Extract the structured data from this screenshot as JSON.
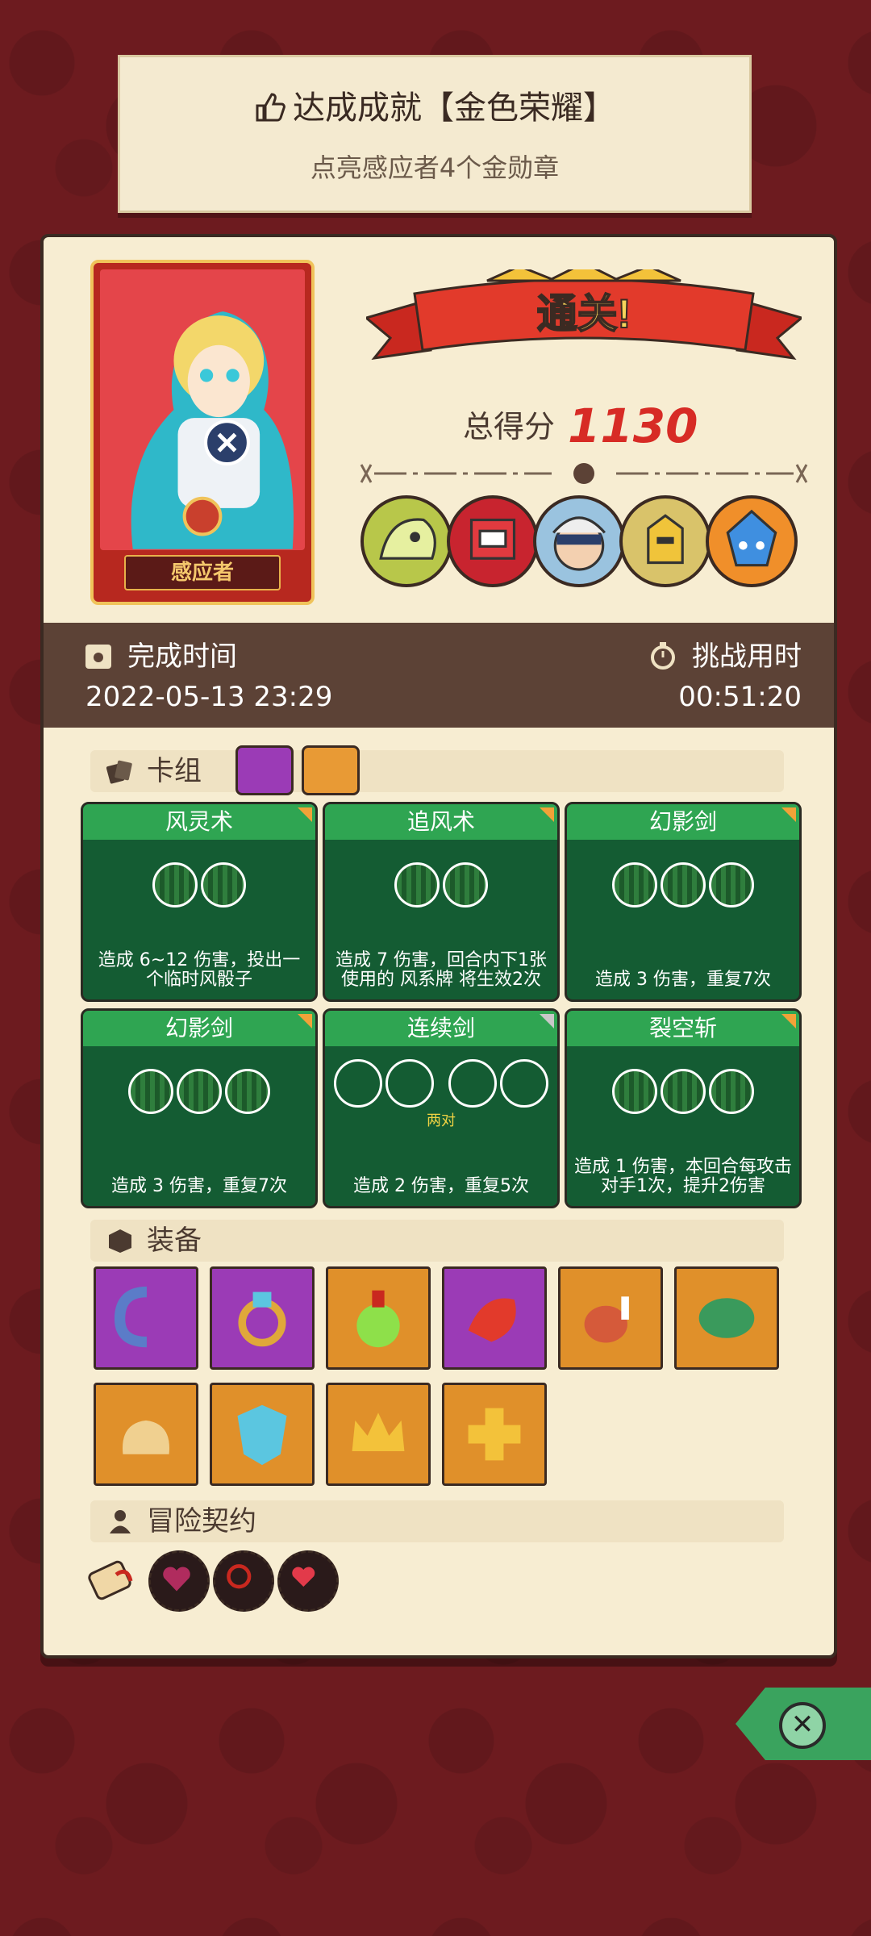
{
  "achievement": {
    "title": "达成成就【金色荣耀】",
    "subtitle": "点亮感应者4个金勋章"
  },
  "hero": {
    "name": "感应者"
  },
  "result": {
    "banner": "通关!",
    "score_label": "总得分",
    "score": "1130"
  },
  "bosses": [
    "skull-dino-boss",
    "red-robot-boss",
    "masked-kid-boss",
    "golden-knight-boss",
    "blue-crystal-boss"
  ],
  "times": {
    "complete_label": "完成时间",
    "complete_value": "2022-05-13 23:29",
    "challenge_label": "挑战用时",
    "challenge_value": "00:51:20"
  },
  "deck": {
    "title": "卡组",
    "cards": [
      {
        "name": "风灵术",
        "orbs": 2,
        "desc": "造成 6~12 伤害，投出一个临时风骰子"
      },
      {
        "name": "追风术",
        "orbs": 2,
        "desc": "造成 7 伤害，回合内下1张使用的 风系牌 将生效2次"
      },
      {
        "name": "幻影剑",
        "orbs": 3,
        "desc": "造成 3 伤害，重复7次"
      },
      {
        "name": "幻影剑",
        "orbs": 3,
        "desc": "造成 3 伤害，重复7次"
      },
      {
        "name": "连续剑",
        "orbs": 0,
        "pair": "两对",
        "desc": "造成 2 伤害，重复5次"
      },
      {
        "name": "裂空斩",
        "orbs": 3,
        "desc": "造成 1 伤害，本回合每攻击对手1次，提升2伤害"
      }
    ]
  },
  "equipment": {
    "title": "装备",
    "items": [
      "hook-icon",
      "ring-icon",
      "potion-icon",
      "red-dragon-icon",
      "meat-icon",
      "turtle-shell-icon",
      "sack-icon",
      "shield-icon",
      "crown-icon",
      "cross-medal-icon"
    ],
    "colors": [
      "#9b3bb6",
      "#9b3bb6",
      "#e0902a",
      "#9b3bb6",
      "#e0902a",
      "#e0902a",
      "#e0902a",
      "#e0902a",
      "#e0902a",
      "#e0902a"
    ]
  },
  "contracts": {
    "title": "冒险契约"
  },
  "colors": {
    "bg": "#6d1b1f",
    "card_green": "#145c33",
    "header_green": "#2fa552",
    "score_red": "#d72b25"
  }
}
